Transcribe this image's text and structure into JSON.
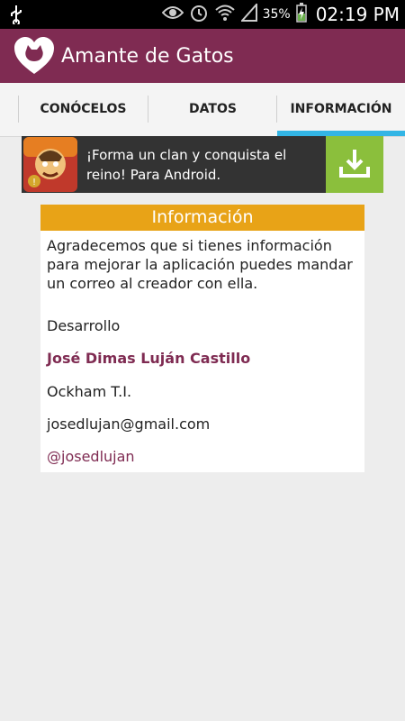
{
  "status_bar": {
    "battery_percent": "35%",
    "time": "02:19 PM",
    "icons": [
      "usb-icon",
      "eye-icon",
      "alarm-icon",
      "wifi-icon",
      "signal-icon",
      "battery-charging-icon"
    ]
  },
  "app_bar": {
    "title": "Amante de Gatos",
    "logo_icon": "cat-heart-logo-icon"
  },
  "tabs": [
    {
      "label": "CONÓCELOS",
      "selected": false
    },
    {
      "label": "DATOS",
      "selected": false
    },
    {
      "label": "INFORMACIÓN",
      "selected": true
    }
  ],
  "ad": {
    "text": "¡Forma un clan y conquista el reino! Para Android.",
    "icon": "game-app-icon",
    "button_icon": "download-icon",
    "colors": {
      "button": "#8bbf3c",
      "background": "#333333"
    }
  },
  "info_card": {
    "header": "Información",
    "paragraph": "Agradecemos que si tienes información para mejorar la aplicación puedes mandar un correo al creador con ella.",
    "development_label": "Desarrollo",
    "developer_name": "José Dimas Luján Castillo",
    "company": "Ockham T.I.",
    "email": "josedlujan@gmail.com",
    "twitter": "@josedlujan"
  },
  "colors": {
    "primary": "#7f2b52",
    "card_header": "#e8a317",
    "tab_indicator": "#33b5e5"
  }
}
